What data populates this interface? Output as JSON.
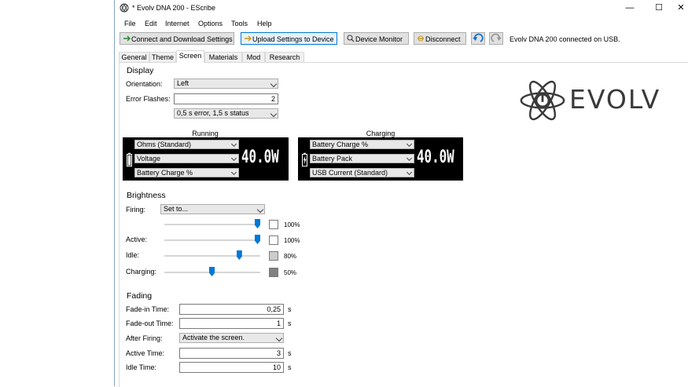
{
  "window": {
    "title": "* Evolv DNA 200 - EScribe"
  },
  "menu": [
    "File",
    "Edit",
    "Internet",
    "Options",
    "Tools",
    "Help"
  ],
  "toolbar": {
    "connect_label": "Connect and Download Settings",
    "upload_label": "Upload Settings to Device",
    "monitor_label": "Device Monitor",
    "disconnect_label": "Disconnect",
    "status": "Evolv DNA 200 connected on USB."
  },
  "tabs": [
    "General",
    "Theme",
    "Screen",
    "Materials",
    "Mod",
    "Research"
  ],
  "active_tab": "Screen",
  "logo_text": "EVOLV",
  "display": {
    "heading": "Display",
    "orientation_label": "Orientation:",
    "orientation_value": "Left",
    "error_flashes_label": "Error Flashes:",
    "error_flashes_value": "2",
    "flash_timing_value": "0,5 s error, 1,5 s status"
  },
  "running": {
    "caption": "Running",
    "rows": [
      "Ohms (Standard)",
      "Voltage",
      "Battery Charge %"
    ],
    "watts": "40.0W"
  },
  "charging": {
    "caption": "Charging",
    "rows": [
      "Battery Charge %",
      "Battery Pack",
      "USB Current (Standard)"
    ],
    "watts": "40.0W"
  },
  "brightness": {
    "heading": "Brightness",
    "firing_label": "Firing:",
    "firing_mode": "Set to...",
    "sliders": [
      {
        "label": "",
        "percent": "100%",
        "level": 1.0,
        "color": "#ffffff"
      },
      {
        "label": "Active:",
        "percent": "100%",
        "level": 1.0,
        "color": "#ffffff"
      },
      {
        "label": "Idle:",
        "percent": "80%",
        "level": 0.8,
        "color": "#cccccc"
      },
      {
        "label": "Charging:",
        "percent": "50%",
        "level": 0.5,
        "color": "#808080"
      }
    ]
  },
  "fading": {
    "heading": "Fading",
    "fade_in_label": "Fade-in Time:",
    "fade_in_value": "0,25",
    "fade_out_label": "Fade-out Time:",
    "fade_out_value": "1",
    "after_firing_label": "After Firing:",
    "after_firing_value": "Activate the screen.",
    "active_time_label": "Active Time:",
    "active_time_value": "3",
    "idle_time_label": "Idle Time:",
    "idle_time_value": "10",
    "unit": "s"
  },
  "colors": {
    "accent": "#0078d7",
    "screen_bg": "#000000",
    "logo": "#3a3a3a"
  }
}
